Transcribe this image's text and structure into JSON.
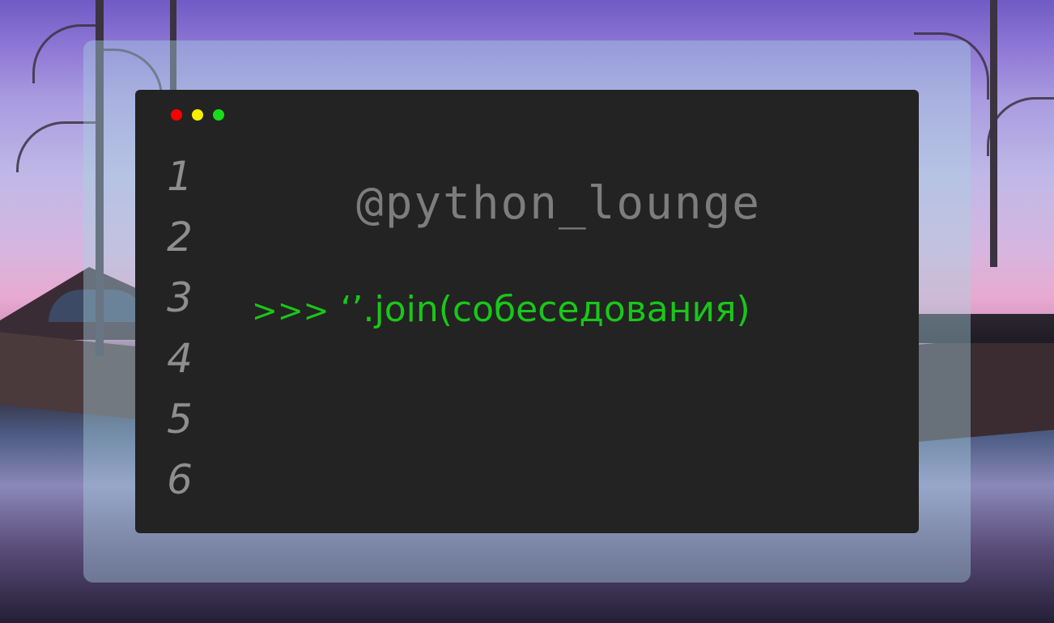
{
  "window": {
    "controls": [
      {
        "name": "close",
        "color": "#ff0000"
      },
      {
        "name": "minimize",
        "color": "#f4f000"
      },
      {
        "name": "maximize",
        "color": "#18dd18"
      }
    ]
  },
  "editor": {
    "line_numbers": [
      "1",
      "2",
      "3",
      "4",
      "5",
      "6"
    ],
    "handle": "@python_lounge",
    "prompt": ">>>",
    "code": "‘’.join(собеседования)"
  },
  "colors": {
    "terminal_bg": "#232323",
    "code_green": "#19c719",
    "muted_gray": "#7d7d7d"
  }
}
